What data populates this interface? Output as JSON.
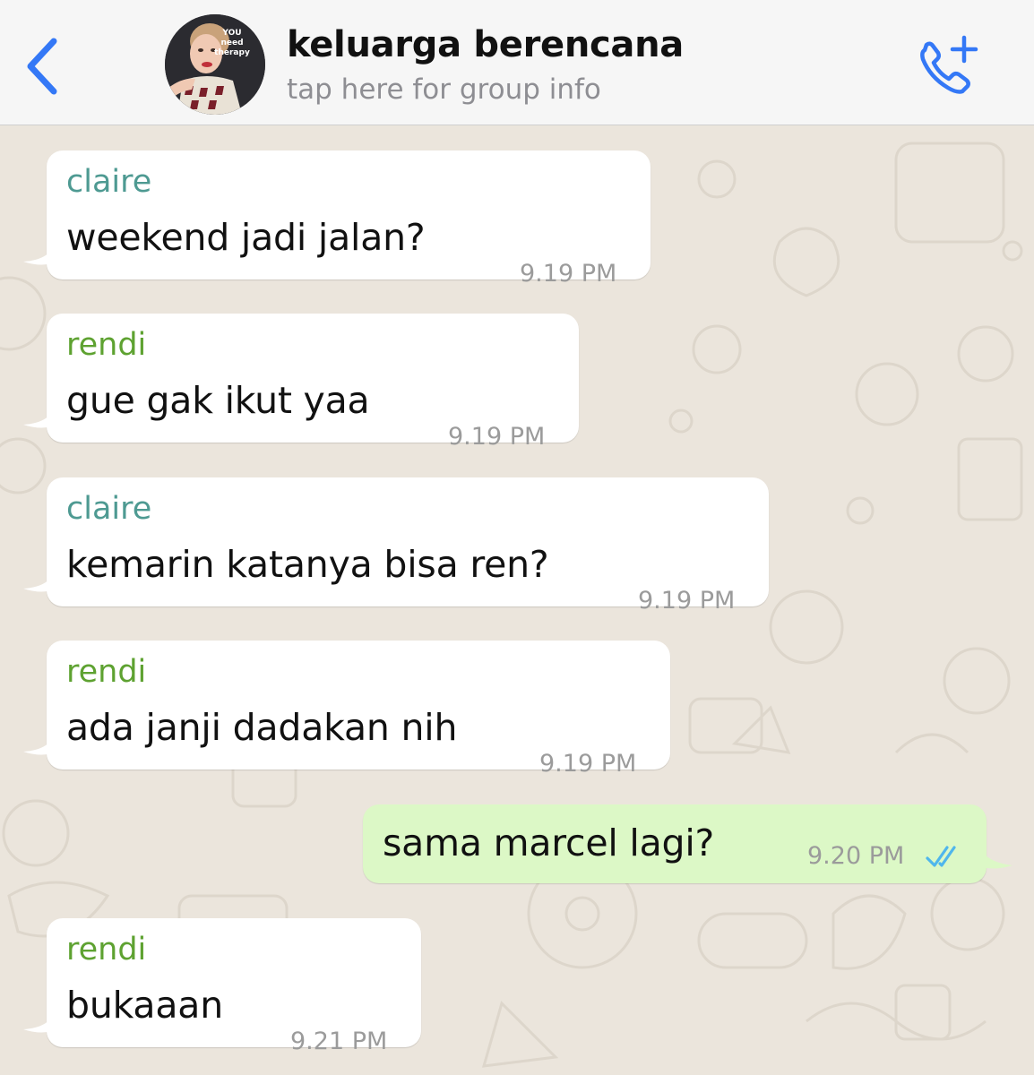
{
  "header": {
    "title": "keluarga berencana",
    "subtitle": "tap here for group info",
    "avatar_text": [
      "YOU",
      "need",
      "therapy"
    ]
  },
  "colors": {
    "accent": "#3478f6",
    "claire": "#4e9a92",
    "rendi": "#5ea231",
    "outgoing_bubble": "#dcf8c6",
    "incoming_bubble": "#ffffff",
    "read_ticks": "#4fb6ec"
  },
  "icons": {
    "back": "chevron-left-icon",
    "call": "phone-plus-icon",
    "read": "double-check-icon"
  },
  "messages": [
    {
      "direction": "in",
      "sender": "claire",
      "text": "weekend jadi jalan?",
      "time": "9.19 PM"
    },
    {
      "direction": "in",
      "sender": "rendi",
      "text": "gue gak ikut yaa",
      "time": "9.19 PM"
    },
    {
      "direction": "in",
      "sender": "claire",
      "text": "kemarin katanya bisa ren?",
      "time": "9.19 PM"
    },
    {
      "direction": "in",
      "sender": "rendi",
      "text": "ada janji dadakan nih",
      "time": "9.19 PM"
    },
    {
      "direction": "out",
      "sender": "",
      "text": "sama marcel lagi?",
      "time": "9.20 PM",
      "status": "read"
    },
    {
      "direction": "in",
      "sender": "rendi",
      "text": "bukaaan",
      "time": "9.21 PM"
    }
  ]
}
